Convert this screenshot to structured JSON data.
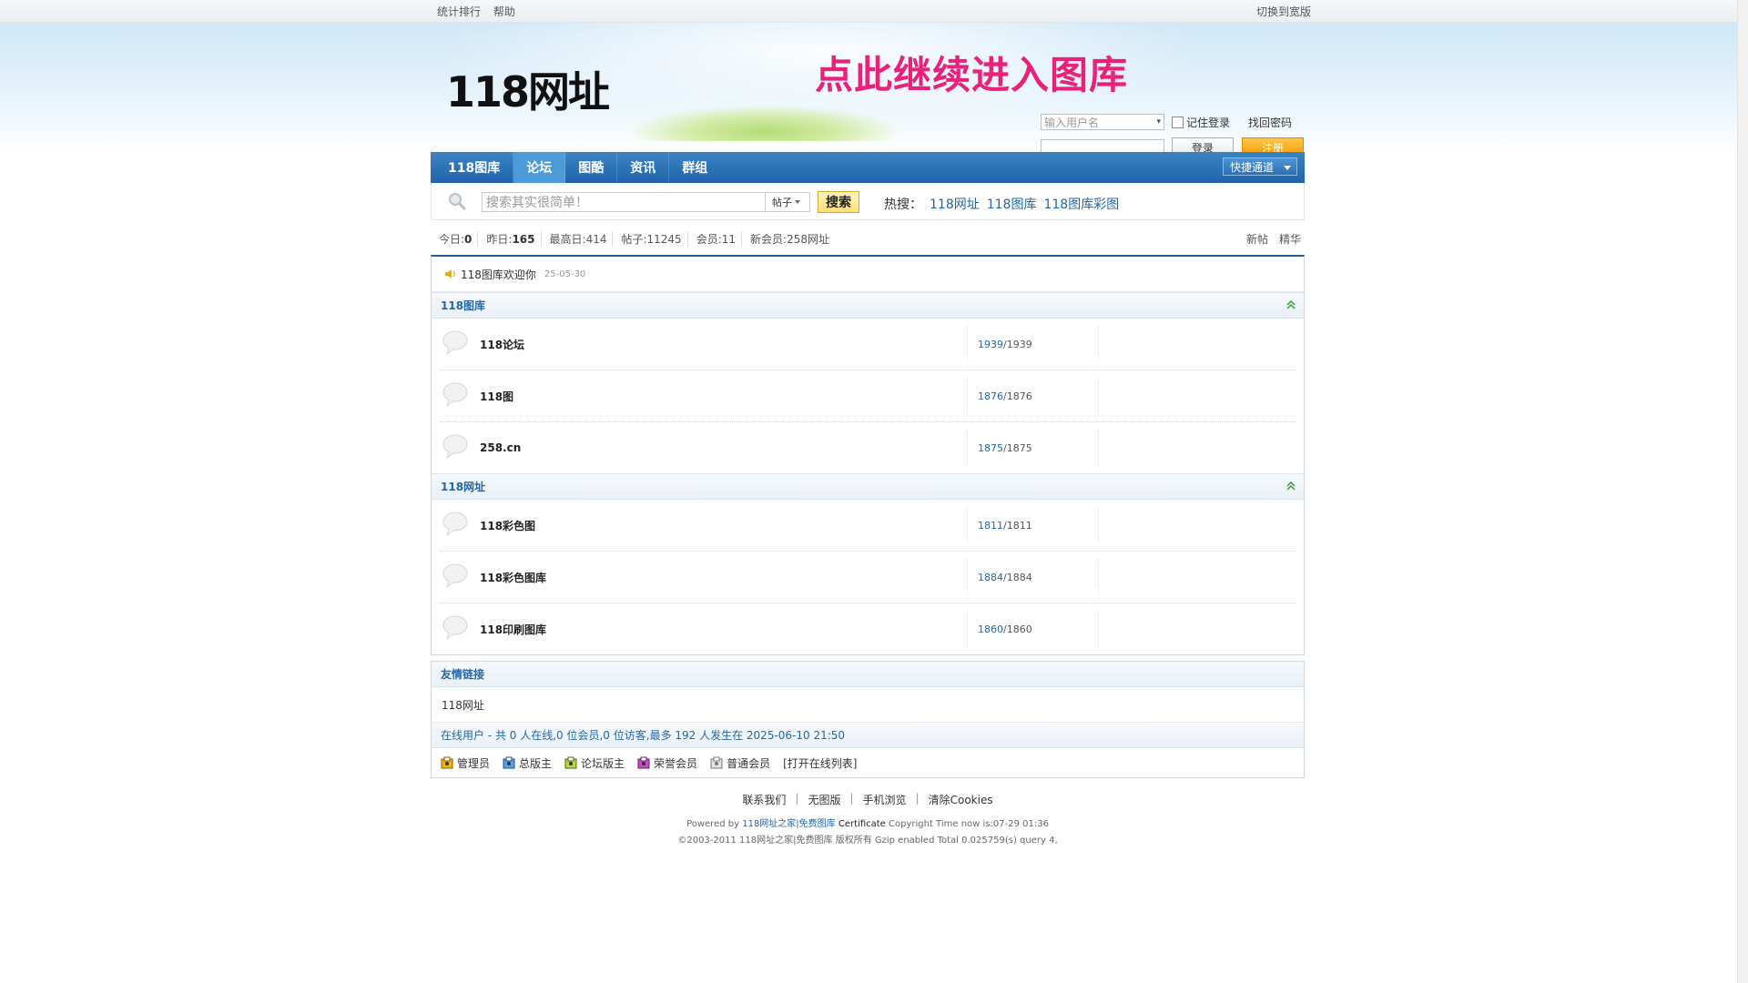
{
  "topbar": {
    "left": [
      "统计排行",
      "帮助"
    ],
    "right": "切换到宽版"
  },
  "header": {
    "logo": "118网址",
    "banner": "点此继续进入图库",
    "login": {
      "username_placeholder": "输入用户名",
      "remember": "记住登录",
      "find_password": "找回密码",
      "login_button": "登录",
      "register_button": "注册"
    }
  },
  "nav": {
    "items": [
      "118图库",
      "论坛",
      "图酷",
      "资讯",
      "群组"
    ],
    "active": "论坛",
    "quick": "快捷通道"
  },
  "search": {
    "placeholder": "搜索其实很简单！",
    "type": "帖子",
    "button": "搜索",
    "hot_label": "热搜：",
    "hot_links": [
      "118网址",
      "118图库",
      "118图库彩图"
    ]
  },
  "stats": {
    "today_label": "今日:",
    "today": "0",
    "yesterday_label": "昨日:",
    "yesterday": "165",
    "max_label": "最高日:",
    "max": "414",
    "posts_label": "帖子:",
    "posts": "11245",
    "members_label": "会员:",
    "members": "11",
    "new_member_label": "新会员:",
    "new_member": "258网址",
    "right_links": [
      "新帖",
      "精华"
    ]
  },
  "notice": {
    "text": "118图库欢迎你",
    "date": "25-05-30"
  },
  "categories": [
    {
      "title": "118图库",
      "forums": [
        {
          "name": "118论坛",
          "threads": "1939",
          "posts": "/1939"
        },
        {
          "name": "118图",
          "threads": "1876",
          "posts": "/1876"
        },
        {
          "name": "258.cn",
          "threads": "1875",
          "posts": "/1875"
        }
      ]
    },
    {
      "title": "118网址",
      "forums": [
        {
          "name": "118彩色图",
          "threads": "1811",
          "posts": "/1811"
        },
        {
          "name": "118彩色图库",
          "threads": "1884",
          "posts": "/1884"
        },
        {
          "name": "118印刷图库",
          "threads": "1860",
          "posts": "/1860"
        }
      ]
    }
  ],
  "friend_links": {
    "title": "友情链接",
    "items": [
      "118网址"
    ],
    "online": "在线用户 - 共 0 人在线,0 位会员,0 位访客,最多 192 人发生在 2025-06-10 21:50",
    "legend": [
      "管理员",
      "总版主",
      "论坛版主",
      "荣誉会员",
      "普通会员"
    ],
    "open_list": "[打开在线列表]"
  },
  "footer": {
    "links": [
      "联系我们",
      "无图版",
      "手机浏览",
      "清除Cookies"
    ],
    "powered_prefix": "Powered by",
    "powered_link": "118网址之家|免费图库",
    "certificate": "Certificate",
    "powered_suffix": "Copyright Time now is:07-29 01:36",
    "copyright_prefix": "©2003-2011",
    "copyright_site": "118网址之家|免费图库",
    "copyright_suffix": "版权所有 Gzip enabled Total 0.025759(s) query 4,"
  },
  "colors": {
    "nav": "#2064a8",
    "link": "#2367a8",
    "banner": "#e8217a",
    "register": "#f39a00"
  }
}
